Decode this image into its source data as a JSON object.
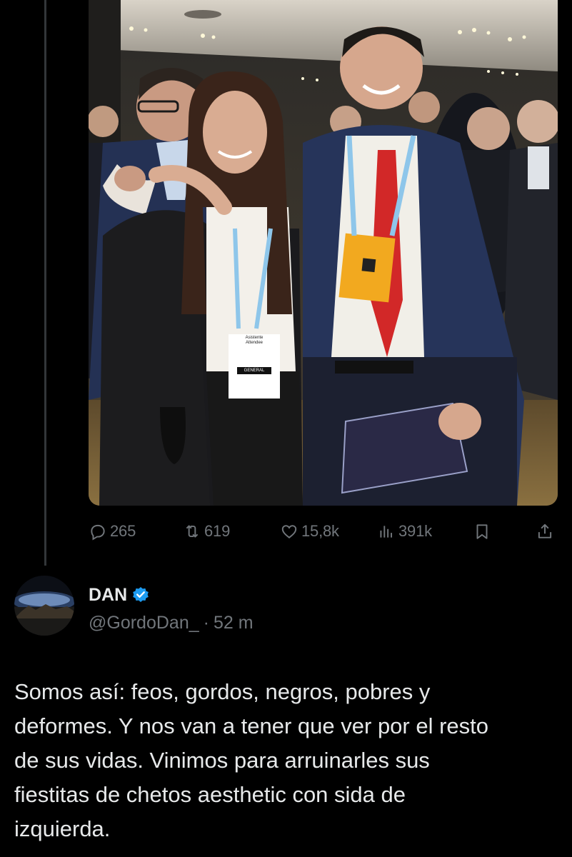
{
  "photo": {
    "badge_name_text": "Asistente\nAttendee",
    "badge_type_text": "GENERAL"
  },
  "actions": {
    "replies": "265",
    "reposts": "619",
    "likes": "15,8k",
    "views": "391k"
  },
  "reply": {
    "display_name": "DAN",
    "handle": "@GordoDan_",
    "separator": "·",
    "time": "52 m",
    "text": "Somos así: feos, gordos, negros, pobres y\ndeformes. Y nos van a tener que ver por el resto\nde sus vidas. Vinimos para arruinarles sus\nfiestitas de chetos aesthetic con sida de\nizquierda."
  },
  "colors": {
    "background": "#000000",
    "text_primary": "#e7e9ea",
    "text_secondary": "#71767b",
    "verified_blue": "#1d9bf0",
    "thread_line": "#333639"
  },
  "icons": [
    "reply-icon",
    "repost-icon",
    "like-icon",
    "views-icon",
    "bookmark-icon",
    "share-icon",
    "verified-badge-icon"
  ]
}
